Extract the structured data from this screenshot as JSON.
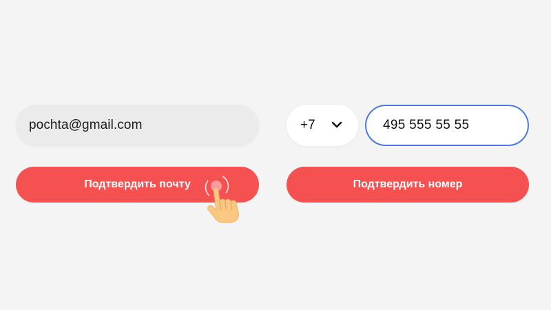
{
  "email_form": {
    "email_value": "pochta@gmail.com",
    "confirm_label": "Подтвердить почту"
  },
  "phone_form": {
    "country_code": "+7",
    "phone_value": "495 555 55 55",
    "confirm_label": "Подтвердить номер"
  },
  "colors": {
    "background": "#f4f4f4",
    "accent": "#f55151",
    "focus_border": "#4a78e0",
    "email_field_bg": "#ebebeb"
  },
  "icons": {
    "country_dropdown": "chevron-down-icon",
    "cursor": "pointing-hand-icon"
  }
}
